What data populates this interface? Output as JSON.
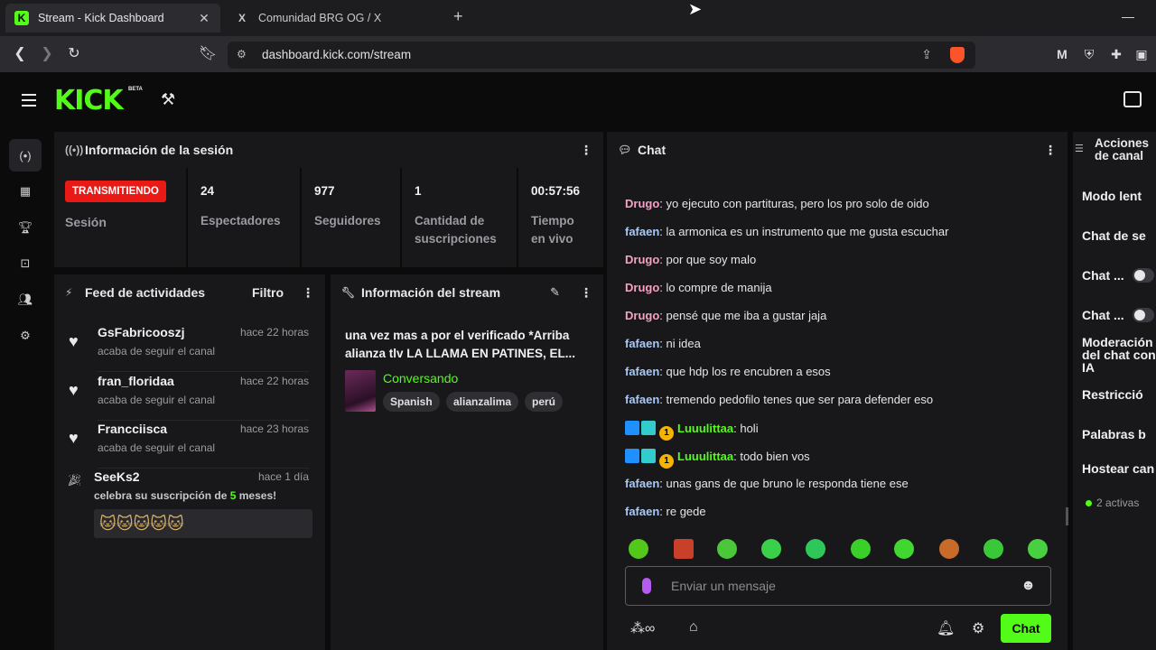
{
  "browser": {
    "tabs": [
      {
        "title": "Stream - Kick Dashboard",
        "favicon": "K",
        "active": true
      },
      {
        "title": "Comunidad BRG OG / X",
        "favicon": "X",
        "active": false
      }
    ],
    "url": "dashboard.kick.com/stream"
  },
  "header": {
    "logo": "KICK",
    "beta": "BETA"
  },
  "session": {
    "title": "Información de la sesión",
    "live_badge": "TRANSMITIENDO",
    "session_label": "Sesión",
    "stats": [
      {
        "value": "24",
        "label": "Espectadores"
      },
      {
        "value": "977",
        "label": "Seguidores"
      },
      {
        "value": "1",
        "label": "Cantidad de suscripciones"
      },
      {
        "value": "00:57:56",
        "label": "Tiempo en vivo"
      }
    ]
  },
  "feed": {
    "title": "Feed de actividades",
    "filter": "Filtro",
    "items": [
      {
        "name": "GsFabricooszj",
        "time": "hace 22 horas",
        "text": "acaba de seguir el canal"
      },
      {
        "name": "fran_floridaa",
        "time": "hace 22 horas",
        "text": "acaba de seguir el canal"
      },
      {
        "name": "Francciisca",
        "time": "hace 23 horas",
        "text": "acaba de seguir el canal"
      }
    ],
    "sub_item": {
      "name": "SeeKs2",
      "time": "hace 1 día",
      "text_before": "celebra su suscripción de ",
      "months": "5",
      "text_after": " meses!"
    }
  },
  "stream_info": {
    "title": "Información del stream",
    "stream_title": "una vez mas a por el verificado *Arriba alianza tlv LA LLAMA EN PATINES, EL...",
    "category": "Conversando",
    "tags": [
      "Spanish",
      "alianzalima",
      "perú"
    ]
  },
  "chat": {
    "title": "Chat",
    "messages": [
      {
        "user": "Drugo",
        "text": "yo ejecuto con partituras, pero los pro solo de oido",
        "cls": "drugo"
      },
      {
        "user": "fafaen",
        "text": "la armonica es un instrumento que me gusta escuchar",
        "cls": "fafaen"
      },
      {
        "user": "Drugo",
        "text": "por que soy malo",
        "cls": "drugo"
      },
      {
        "user": "Drugo",
        "text": "lo compre de manija",
        "cls": "drugo"
      },
      {
        "user": "Drugo",
        "text": "pensé que me iba a gustar jaja",
        "cls": "drugo"
      },
      {
        "user": "fafaen",
        "text": "ni idea",
        "cls": "fafaen"
      },
      {
        "user": "fafaen",
        "text": "que hdp los re encubren a esos",
        "cls": "fafaen"
      },
      {
        "user": "fafaen",
        "text": "tremendo pedofilo tenes que ser para defender eso",
        "cls": "fafaen"
      },
      {
        "user": "Luuulittaa",
        "text": "holi",
        "cls": "luu"
      },
      {
        "user": "Luuulittaa",
        "text": "todo bien vos",
        "cls": "luu"
      },
      {
        "user": "fafaen",
        "text": "unas gans de que bruno le responda tiene ese",
        "cls": "fafaen"
      },
      {
        "user": "fafaen",
        "text": "re gede",
        "cls": "fafaen"
      }
    ],
    "badge_count": "1",
    "input_placeholder": "Enviar un mensaje",
    "send_label": "Chat"
  },
  "actions": {
    "title": "Acciones de canal",
    "items": [
      "Modo lent",
      "Chat de se",
      "Chat ...",
      "Chat ...",
      "Moderación del chat con IA",
      "Restricció",
      "Palabras b",
      "Hostear can"
    ],
    "active_count": "2 activas"
  },
  "colors": {
    "accent": "#53fc18",
    "live": "#e91916"
  }
}
